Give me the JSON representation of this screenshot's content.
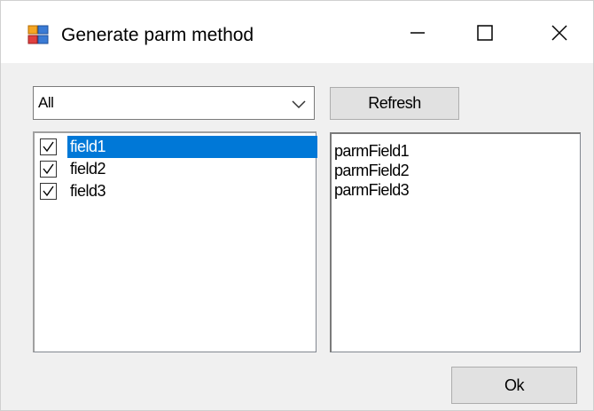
{
  "window": {
    "title": "Generate parm method"
  },
  "filter": {
    "selected": "All"
  },
  "toolbar": {
    "refresh_label": "Refresh",
    "ok_label": "Ok"
  },
  "fields": [
    {
      "label": "field1",
      "checked": true,
      "selected": true
    },
    {
      "label": "field2",
      "checked": true,
      "selected": false
    },
    {
      "label": "field3",
      "checked": true,
      "selected": false
    }
  ],
  "output": [
    "parmField1",
    "parmField2",
    "parmField3"
  ],
  "colors": {
    "selection": "#0078d7",
    "dialog_bg": "#f0f0f0",
    "button_bg": "#e1e1e1"
  },
  "icons": {
    "app": "app-form-icon",
    "minimize": "minimize-icon",
    "maximize": "maximize-icon",
    "close": "close-icon",
    "dropdown": "chevron-down-icon",
    "check": "checkmark-icon"
  }
}
